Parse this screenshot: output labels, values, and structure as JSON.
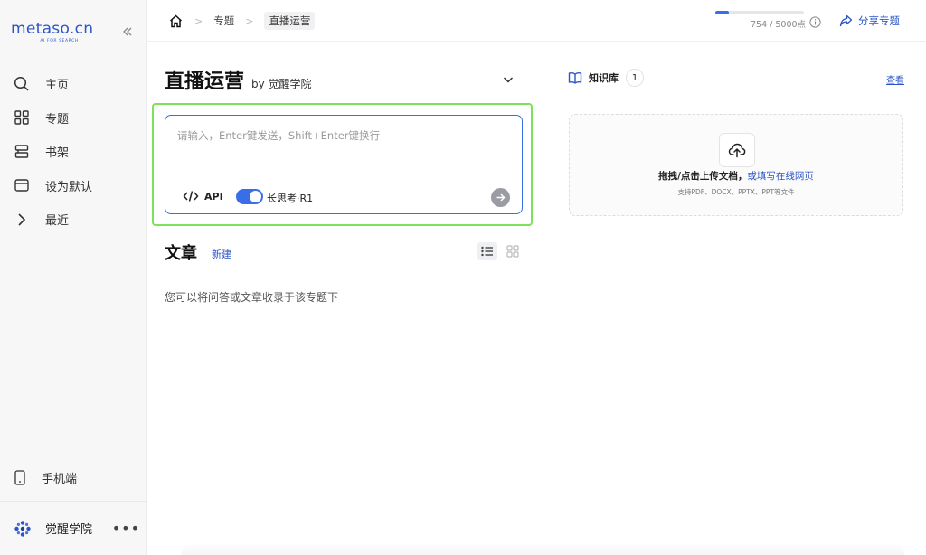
{
  "sidebar": {
    "logo": "metaso.cn",
    "logo_sub": "AI FOR SEARCH",
    "collapse_icon": "double-chevron-left-icon",
    "items": [
      {
        "label": "主页",
        "icon": "search-icon"
      },
      {
        "label": "专题",
        "icon": "grid-icon"
      },
      {
        "label": "书架",
        "icon": "bookshelf-icon"
      },
      {
        "label": "设为默认",
        "icon": "window-icon"
      },
      {
        "label": "最近",
        "icon": "chevron-right-icon"
      }
    ],
    "mobile_label": "手机端",
    "user_name": "觉醒学院",
    "more": "•••"
  },
  "header": {
    "breadcrumb": [
      "专题",
      "直播运营"
    ],
    "quota_text": "754 / 5000点",
    "quota_progress": 0.15,
    "share_label": "分享专题"
  },
  "topic": {
    "title": "直播运营",
    "byline": "by 觉醒学院"
  },
  "input": {
    "placeholder": "请输入，Enter键发送，Shift+Enter键换行",
    "api_label": "API",
    "think_label": "长思考·R1",
    "think_enabled": true
  },
  "articles": {
    "title": "文章",
    "new_label": "新建",
    "empty_message": "您可以将问答或文章收录于该专题下"
  },
  "knowledge": {
    "label": "知识库",
    "count": "1",
    "view_label": "查看",
    "upload_text": "拖拽/点击上传文档，",
    "upload_link": "或填写在线网页",
    "upload_hint": "支持PDF、DOCX、PPTX、PPT等文件"
  },
  "colors": {
    "accent": "#3a6ee8",
    "brand": "#2b55c8",
    "highlight": "#7de25a"
  }
}
